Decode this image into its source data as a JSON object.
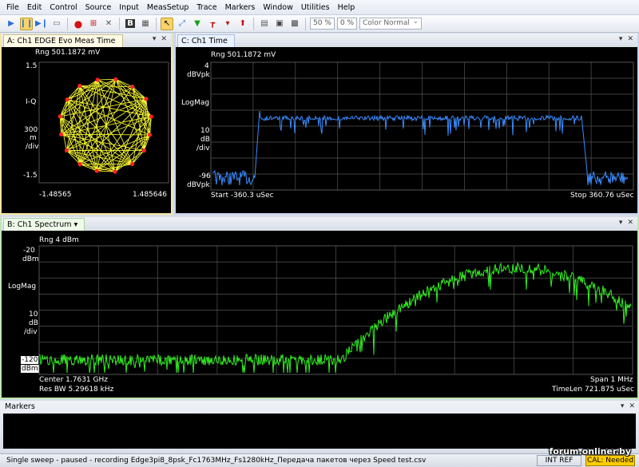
{
  "menu": [
    "File",
    "Edit",
    "Control",
    "Source",
    "Input",
    "MeasSetup",
    "Trace",
    "Markers",
    "Window",
    "Utilities",
    "Help"
  ],
  "toolbar": {
    "field1": "50 %",
    "field2": "0 %",
    "color_mode": "Color Normal"
  },
  "panels": {
    "iq": {
      "tab": "A: Ch1 EDGE Evo Meas Time",
      "range": "Rng 501.1872 mV",
      "y_top": "1.5",
      "y_label": "I-Q",
      "y_scale": [
        "300",
        "m",
        "/div"
      ],
      "y_bottom": "-1.5",
      "x_left": "-1.48565",
      "x_right": "1.485646"
    },
    "time": {
      "tab": "C: Ch1 Time",
      "range": "Rng 501.1872 mV",
      "y_top": [
        "4",
        "dBVpk"
      ],
      "y_label": "LogMag",
      "y_scale": [
        "10",
        "dB",
        "/div"
      ],
      "y_bottom": [
        "-96",
        "dBVpk"
      ],
      "start": "Start -360.3 uSec",
      "stop": "Stop 360.76 uSec"
    },
    "spectrum": {
      "tab": "B: Ch1 Spectrum",
      "range": "Rng 4 dBm",
      "y_top": [
        "-20",
        "dBm"
      ],
      "y_label": "LogMag",
      "y_scale": [
        "10",
        "dB",
        "/div"
      ],
      "y_bottom": [
        "-120",
        "dBm"
      ],
      "center": "Center 1.7631 GHz",
      "span": "Span 1 MHz",
      "res_bw": "Res BW 5.29618 kHz",
      "timelen": "TimeLen 721.875 uSec"
    },
    "markers": {
      "tab": "Markers"
    }
  },
  "status": {
    "message": "Single sweep - paused - recording Edge3pi8_8psk_Fc1763MHz_Fs1280kHz_Передача пакетов через Speed test.csv",
    "intref": "INT REF",
    "cal": "CAL: Needed"
  },
  "watermark": "forum.onliner.by",
  "colors": {
    "iq_trace": "#ffff33",
    "iq_points": "#ff2222",
    "time_trace": "#3a8cff",
    "spectrum_trace": "#33ee22",
    "grid": "#555555"
  }
}
